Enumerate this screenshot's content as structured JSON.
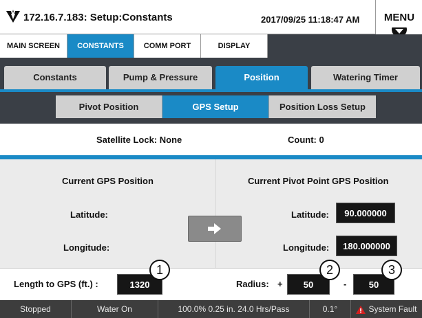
{
  "header": {
    "title": "172.16.7.183: Setup:Constants",
    "datetime": "2017/09/25 11:18:47 AM",
    "menu_label": "MENU"
  },
  "screen_tabs": [
    {
      "label": "MAIN SCREEN",
      "active": false
    },
    {
      "label": "CONSTANTS",
      "active": true
    },
    {
      "label": "COMM PORT",
      "active": false
    },
    {
      "label": "DISPLAY",
      "active": false
    }
  ],
  "sub_tabs": [
    {
      "label": "Constants",
      "active": false
    },
    {
      "label": "Pump & Pressure",
      "active": false
    },
    {
      "label": "Position",
      "active": true
    },
    {
      "label": "Watering Timer",
      "active": false
    }
  ],
  "position_tabs": [
    {
      "label": "Pivot Position",
      "active": false
    },
    {
      "label": "GPS Setup",
      "active": true
    },
    {
      "label": "Position Loss Setup",
      "active": false
    }
  ],
  "satellite": {
    "lock_text": "Satellite Lock: None",
    "count_text": "Count: 0"
  },
  "current_gps": {
    "heading": "Current GPS Position",
    "latitude_label": "Latitude:",
    "longitude_label": "Longitude:"
  },
  "pivot_gps": {
    "heading": "Current Pivot Point GPS Position",
    "latitude_label": "Latitude:",
    "latitude_value": "90.000000",
    "longitude_label": "Longitude:",
    "longitude_value": "180.000000"
  },
  "settings": {
    "length_label": "Length to GPS (ft.) :",
    "length_value": "1320",
    "radius_label": "Radius:",
    "plus_sign": "+",
    "radius_plus_value": "50",
    "minus_sign": "-",
    "radius_minus_value": "50"
  },
  "callouts": [
    "1",
    "2",
    "3"
  ],
  "status": {
    "state": "Stopped",
    "water": "Water On",
    "rate": "100.0%  0.25 in.  24.0 Hrs/Pass",
    "angle": "0.1°",
    "fault": "System Fault"
  },
  "colors": {
    "accent": "#1a8ac6",
    "dark_bar": "#3a3f46",
    "value_box": "#161616",
    "fault_icon": "#d42020"
  },
  "icons": {
    "logo": "valley-logo-icon",
    "menu_arrow": "chevron-down-icon",
    "transfer": "arrow-right-icon",
    "fault": "warning-icon"
  }
}
